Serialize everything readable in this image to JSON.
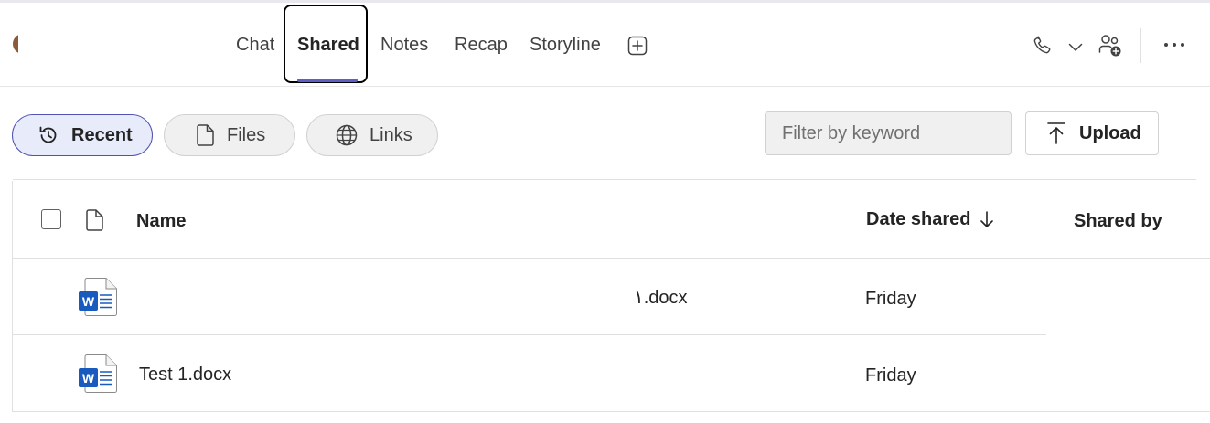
{
  "header": {
    "tabs": [
      {
        "label": "Chat"
      },
      {
        "label": "Shared"
      },
      {
        "label": "Notes"
      },
      {
        "label": "Recap"
      },
      {
        "label": "Storyline"
      }
    ],
    "icons": [
      "add-tab-icon",
      "phone-icon",
      "chevron-down-icon",
      "add-people-icon",
      "more-options-icon"
    ]
  },
  "toolbar": {
    "filters": [
      {
        "label": "Recent",
        "icon": "history-icon",
        "selected": true
      },
      {
        "label": "Files",
        "icon": "file-icon",
        "selected": false
      },
      {
        "label": "Links",
        "icon": "globe-icon",
        "selected": false
      }
    ],
    "search": {
      "placeholder": "Filter by keyword",
      "value": ""
    },
    "upload_label": "Upload"
  },
  "table": {
    "columns": {
      "name": "Name",
      "date_shared": "Date shared",
      "shared_by": "Shared by"
    },
    "sort": {
      "column": "date_shared",
      "direction": "descending"
    },
    "rows": [
      {
        "name": "١.docx",
        "date": "Friday",
        "icon": "word-doc-icon"
      },
      {
        "name": "Test 1.docx",
        "date": "Friday",
        "icon": "word-doc-icon"
      }
    ]
  },
  "colors": {
    "accent": "#5b5fc7",
    "selected_pill_bg": "#e8ebfa",
    "selected_pill_border": "#4f52b2",
    "word_blue": "#185abd"
  }
}
